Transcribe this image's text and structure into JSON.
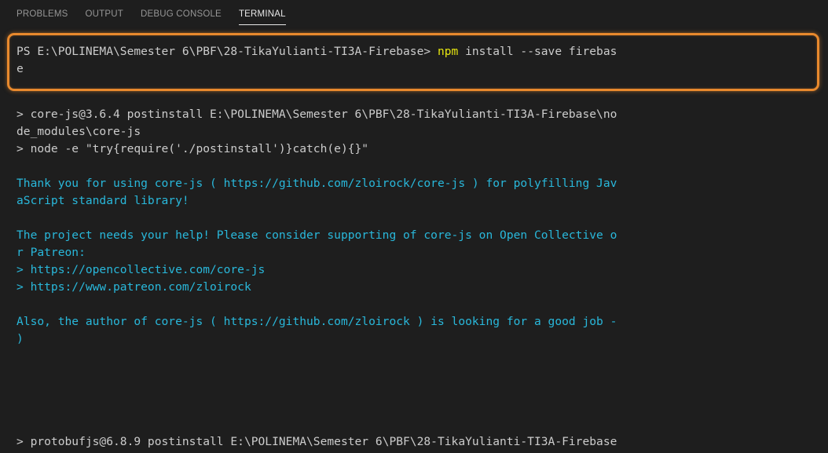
{
  "tabs": [
    {
      "label": "PROBLEMS",
      "active": false
    },
    {
      "label": "OUTPUT",
      "active": false
    },
    {
      "label": "DEBUG CONSOLE",
      "active": false
    },
    {
      "label": "TERMINAL",
      "active": true
    }
  ],
  "terminal": {
    "prompt": "PS E:\\POLINEMA\\Semester 6\\PBF\\28-TikaYulianti-TI3A-Firebase> ",
    "command_name": "npm",
    "command_args": " install --save firebas",
    "command_wrap": "e",
    "lines": [
      {
        "text": "> core-js@3.6.4 postinstall E:\\POLINEMA\\Semester 6\\PBF\\28-TikaYulianti-TI3A-Firebase\\no",
        "style": "plain"
      },
      {
        "text": "de_modules\\core-js",
        "style": "plain"
      },
      {
        "text": "> node -e \"try{require('./postinstall')}catch(e){}\"",
        "style": "plain"
      },
      {
        "text": "",
        "style": "plain"
      },
      {
        "text": "Thank you for using core-js ( https://github.com/zloirock/core-js ) for polyfilling Jav",
        "style": "cyan"
      },
      {
        "text": "aScript standard library!",
        "style": "cyan"
      },
      {
        "text": "",
        "style": "plain"
      },
      {
        "text": "The project needs your help! Please consider supporting of core-js on Open Collective o",
        "style": "cyan"
      },
      {
        "text": "r Patreon:",
        "style": "cyan"
      },
      {
        "text": "> https://opencollective.com/core-js",
        "style": "cyan"
      },
      {
        "text": "> https://www.patreon.com/zloirock",
        "style": "cyan"
      },
      {
        "text": "",
        "style": "plain"
      },
      {
        "text": "Also, the author of core-js ( https://github.com/zloirock ) is looking for a good job -",
        "style": "cyan"
      },
      {
        "text": ")",
        "style": "cyan"
      },
      {
        "text": "",
        "style": "plain"
      },
      {
        "text": "",
        "style": "plain"
      },
      {
        "text": "> protobufjs@6.8.9 postinstall E:\\POLINEMA\\Semester 6\\PBF\\28-TikaYulianti-TI3A-Firebase",
        "style": "plain"
      }
    ]
  },
  "colors": {
    "background": "#1e1e1e",
    "text": "#cccccc",
    "cyan": "#29b8db",
    "command": "#e5e510",
    "highlight": "#e8892d"
  }
}
